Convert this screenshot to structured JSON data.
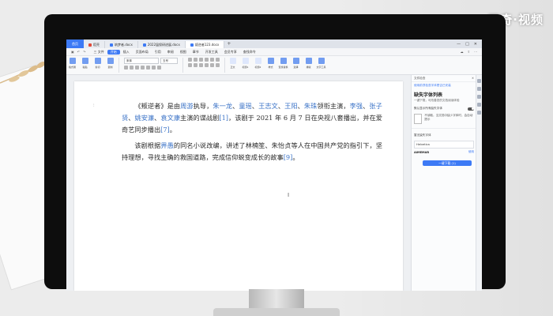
{
  "brand": {
    "text": "天奇·视频"
  },
  "tabs": [
    {
      "label": "首页",
      "active": false
    },
    {
      "label": "稻壳",
      "active": false,
      "icon": "docer-icon",
      "color": "#e04b3a"
    },
    {
      "label": "筑梦者.docx",
      "active": false,
      "icon": "word-doc-icon",
      "color": "#3d7af5"
    },
    {
      "label": "2022届保研进展.docx",
      "active": false,
      "icon": "word-doc-icon",
      "color": "#3d7af5"
    },
    {
      "label": "叛逆者123.docx",
      "active": true,
      "icon": "word-doc-icon",
      "color": "#3d7af5"
    }
  ],
  "menu": {
    "items": [
      "三 文件",
      "开始",
      "插入",
      "页面布局",
      "引用",
      "审阅",
      "视图",
      "章节",
      "开发工具",
      "会员专享",
      "查找命令"
    ],
    "active_index": 1
  },
  "ribbon": {
    "left_buttons": [
      "格式刷",
      "粘贴",
      "剪切",
      "复制"
    ],
    "font_name": "宋体",
    "font_size": "五号",
    "right_buttons": [
      "正文",
      "标题1",
      "标题2",
      "样式",
      "查找替换",
      "选择",
      "排版",
      "文字工具"
    ]
  },
  "document": {
    "para1": {
      "p1": "《叛逆者》是由",
      "director": "周游",
      "p2": "执导，",
      "a1": "朱一龙",
      "s1": "、",
      "a2": "童瑶",
      "s2": "、",
      "a3": "王志文",
      "s3": "、",
      "a4": "王阳",
      "s4": "、",
      "a5": "朱珠",
      "p3": "领衔主演，",
      "a6": "李强",
      "s6": "、",
      "a7": "张子贤",
      "s7": "、",
      "a8": "姚安濂",
      "s8": "、",
      "a9": "袁文康",
      "p4": "主演的谍战剧",
      "cite1": "[1]",
      "p5": "，该剧于 2021 年 6 月 7 日在央视八套播出，并在爱奇艺同步播出",
      "cite2": "[7]",
      "p6": "。"
    },
    "para2": {
      "p1": "该剧根据",
      "author": "畀愚",
      "p2": "的同名小说改编，讲述了林楠笙、朱怡贞等人在中国共产党的指引下，坚持理想，寻找主确的救国道路，完成信仰蜕变成长的故事",
      "cite": "[9]",
      "p3": "。"
    }
  },
  "side_panel": {
    "header": "文件检查",
    "link": "使用前须检查字体是否已安装",
    "title": "缺失字体列表",
    "subtitle": "一键下载，可改善您的文档阅读体验",
    "toggle_label": "默认显示所有缺失字体",
    "card_text": "不读取，当文档中缺少字体时，会自动提示",
    "section": "暂无缺失字体",
    "font_label": "Helvetica",
    "font_name": "AlMEMAR",
    "font_action": "使用",
    "download_button": "一键下载 (1)"
  }
}
